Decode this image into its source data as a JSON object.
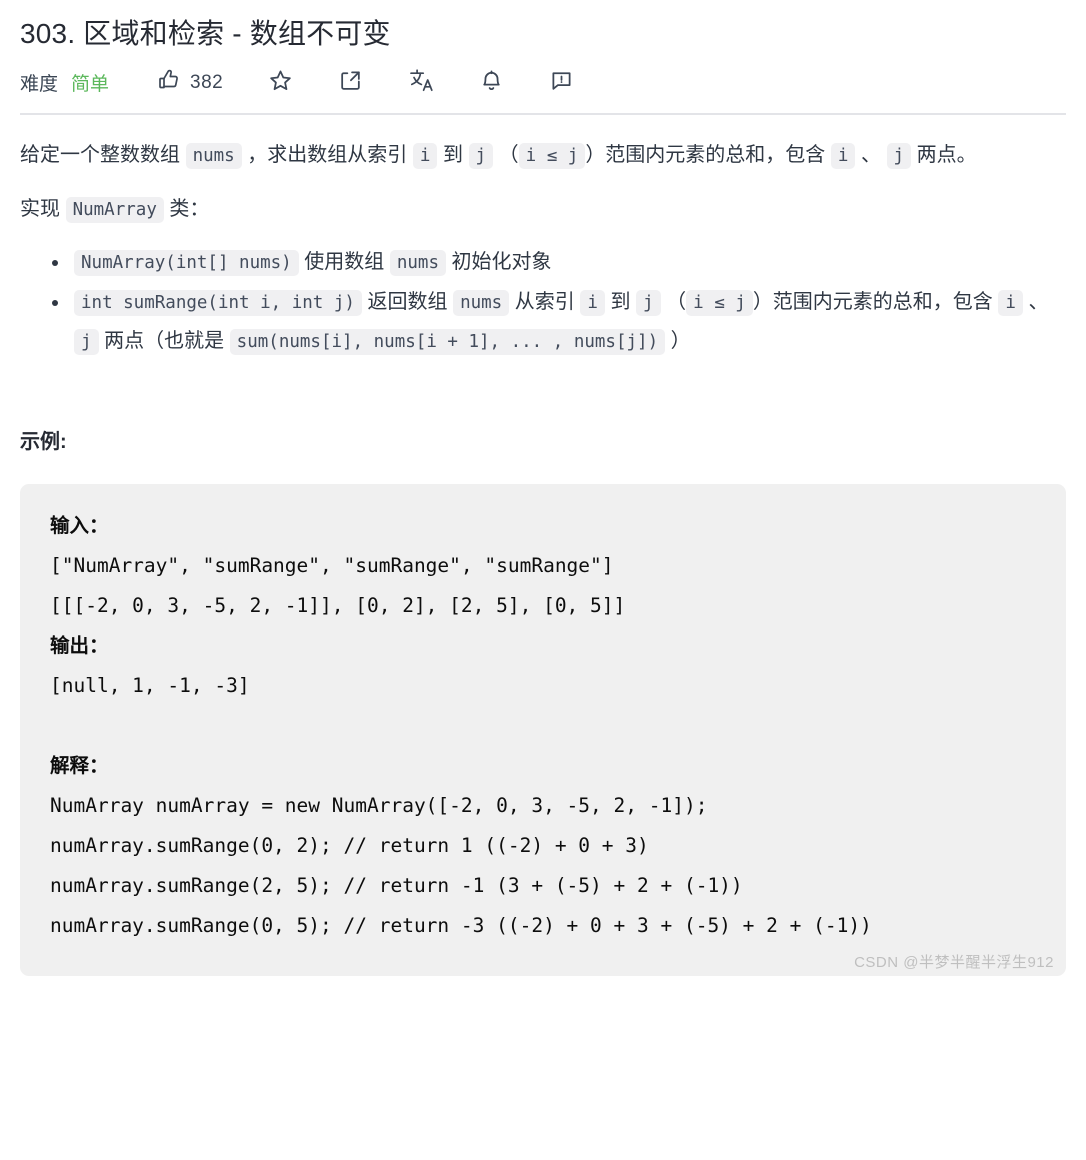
{
  "header": {
    "title": "303. 区域和检索 - 数组不可变",
    "difficulty_label": "难度",
    "difficulty_value": "简单",
    "difficulty_color": "#5cb85c",
    "actions": [
      {
        "icon": "thumbs-up-icon",
        "count": "382"
      },
      {
        "icon": "star-icon",
        "count": ""
      },
      {
        "icon": "share-icon",
        "count": ""
      },
      {
        "icon": "translate-icon",
        "count": ""
      },
      {
        "icon": "bell-icon",
        "count": ""
      },
      {
        "icon": "feedback-icon",
        "count": ""
      }
    ]
  },
  "description": {
    "p1": {
      "t1": "给定一个整数数组 ",
      "c1": "nums",
      "t2": " ，求出数组从索引 ",
      "c2": "i",
      "t3": " 到 ",
      "c3": "j",
      "t4": " （",
      "c4": "i ≤ j",
      "t5": "）范围内元素的总和，包含 ",
      "c5": "i",
      "t6": " 、 ",
      "c6": "j",
      "t7": " 两点。"
    },
    "p2": {
      "t1": "实现 ",
      "c1": "NumArray",
      "t2": " 类："
    },
    "bullets": [
      {
        "c1": "NumArray(int[] nums)",
        "t1": " 使用数组 ",
        "c2": "nums",
        "t2": " 初始化对象"
      },
      {
        "c1": "int sumRange(int i, int j)",
        "t1": " 返回数组 ",
        "c2": "nums",
        "t2": " 从索引 ",
        "c3": "i",
        "t3": " 到 ",
        "c4": "j",
        "t4": " （",
        "c5": "i ≤ j",
        "t5": "）范围内元素的总和，包含 ",
        "c6": "i",
        "t6": " 、 ",
        "c7": "j",
        "t7": " 两点（也就是 ",
        "c8": "sum(nums[i], nums[i + 1], ... , nums[j])",
        "t8": " ）"
      }
    ]
  },
  "example": {
    "heading": "示例:",
    "input_label": "输入：",
    "input_line1": "[\"NumArray\", \"sumRange\", \"sumRange\", \"sumRange\"]",
    "input_line2": "[[[-2, 0, 3, -5, 2, -1]], [0, 2], [2, 5], [0, 5]]",
    "output_label": "输出：",
    "output_line": "[null, 1, -1, -3]",
    "explain_label": "解释：",
    "explain_line1": "NumArray numArray = new NumArray([-2, 0, 3, -5, 2, -1]);",
    "explain_line2": "numArray.sumRange(0, 2); // return 1 ((-2) + 0 + 3)",
    "explain_line3": "numArray.sumRange(2, 5); // return -1 (3 + (-5) + 2 + (-1))",
    "explain_line4": "numArray.sumRange(0, 5); // return -3 ((-2) + 0 + 3 + (-5) + 2 + (-1))"
  },
  "watermark": "CSDN @半梦半醒半浮生912"
}
